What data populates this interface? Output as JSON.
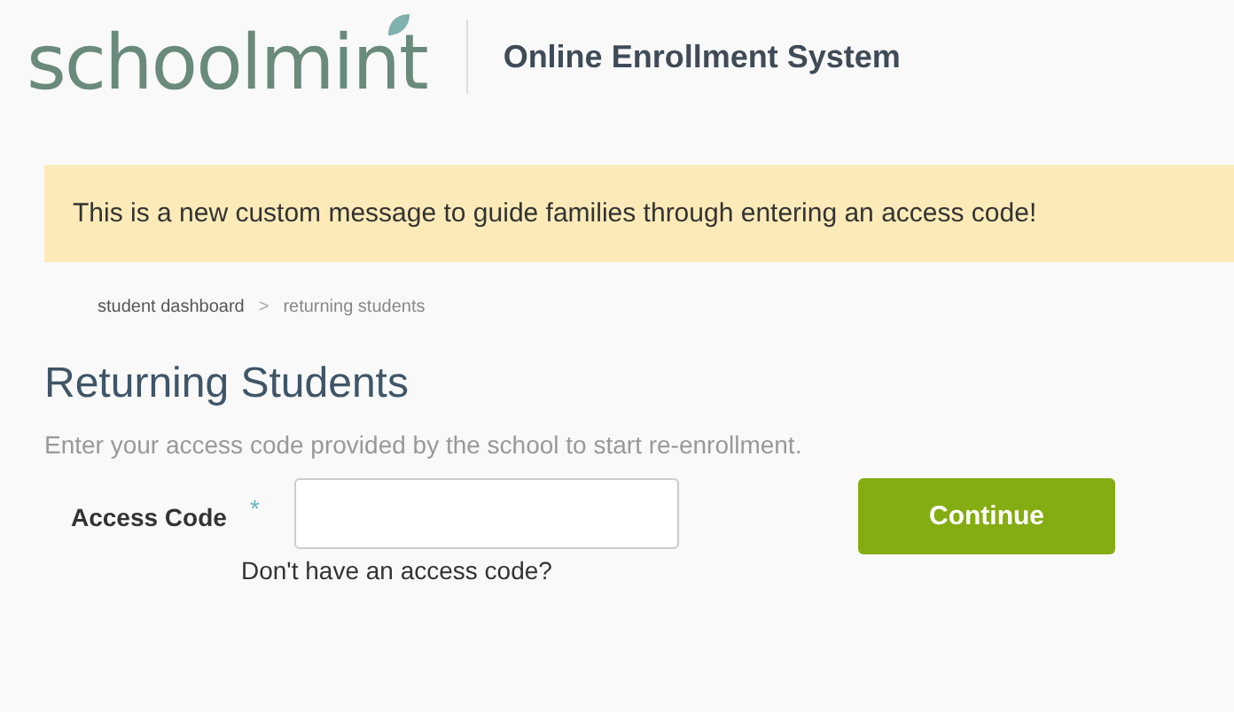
{
  "header": {
    "logo": "schoolmint",
    "title": "Online Enrollment System"
  },
  "banner": {
    "message": "This is a new custom message to guide families through entering an access code!"
  },
  "breadcrumb": [
    {
      "label": "student dashboard"
    },
    {
      "label": ">"
    },
    {
      "label": "returning students"
    }
  ],
  "page": {
    "heading": "Returning Students",
    "instructions": "Enter your access code provided by the school to start re-enrollment."
  },
  "form": {
    "label": "Access Code",
    "required_mark": "*",
    "help_link": "Don't have an access code?",
    "button": "Continue"
  }
}
